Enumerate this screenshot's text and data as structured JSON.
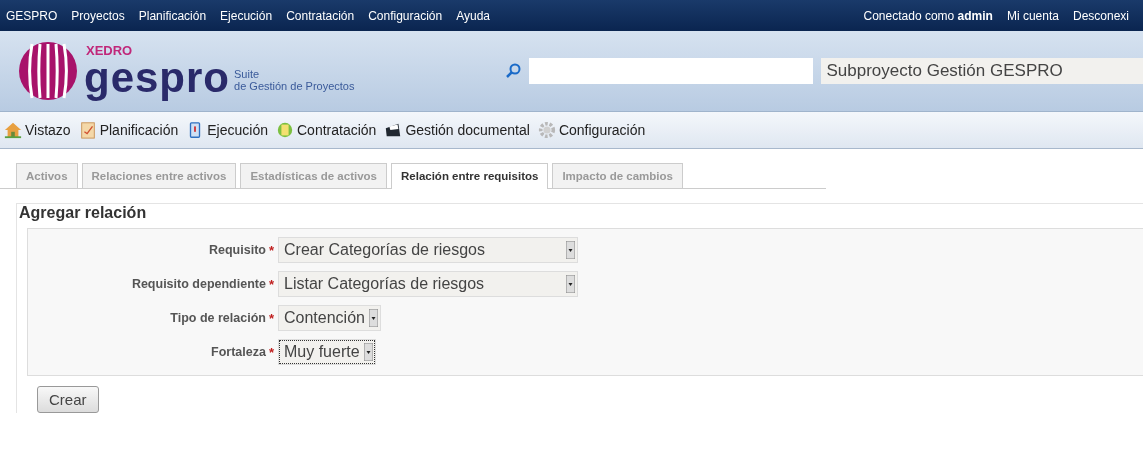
{
  "top_menu": {
    "items": [
      "GESPRO",
      "Proyectos",
      "Planificación",
      "Ejecución",
      "Contratación",
      "Configuración",
      "Ayuda"
    ],
    "logged_in": "Conectado como **admin**",
    "account": "Mi cuenta",
    "logout": "Desconexi"
  },
  "header": {
    "brand_small": "XEDRO",
    "brand": "gespro",
    "tagline_1": "Suite",
    "tagline_2": "de Gestión de Proyectos",
    "project": "Subproyecto Gestión GESPRO"
  },
  "module_nav": [
    {
      "label": "Vistazo",
      "kind": "home"
    },
    {
      "label": "Planificación",
      "kind": "clipboard"
    },
    {
      "label": "Ejecución",
      "kind": "card"
    },
    {
      "label": "Contratación",
      "kind": "notes"
    },
    {
      "label": "Gestión documental",
      "kind": "folder"
    },
    {
      "label": "Configuración",
      "kind": "gear"
    }
  ],
  "tabs": [
    {
      "label": "Activos",
      "selected": false
    },
    {
      "label": "Relaciones entre activos",
      "selected": false
    },
    {
      "label": "Estadísticas de activos",
      "selected": false
    },
    {
      "label": "Relación entre requisitos",
      "selected": true
    },
    {
      "label": "Impacto de cambios",
      "selected": false
    }
  ],
  "form": {
    "legend": "Agregar relación",
    "fields": [
      {
        "label": "Requisito",
        "required": "*",
        "value": "Crear Categorías de riesgos",
        "focused": false
      },
      {
        "label": "Requisito dependiente",
        "required": "*",
        "value": "Listar Categorías de riesgos",
        "focused": false
      },
      {
        "label": "Tipo de relación",
        "required": "*",
        "value": "Contención",
        "focused": false
      },
      {
        "label": "Fortaleza",
        "required": "*",
        "value": "Muy fuerte",
        "focused": true
      }
    ],
    "submit": "Crear"
  }
}
